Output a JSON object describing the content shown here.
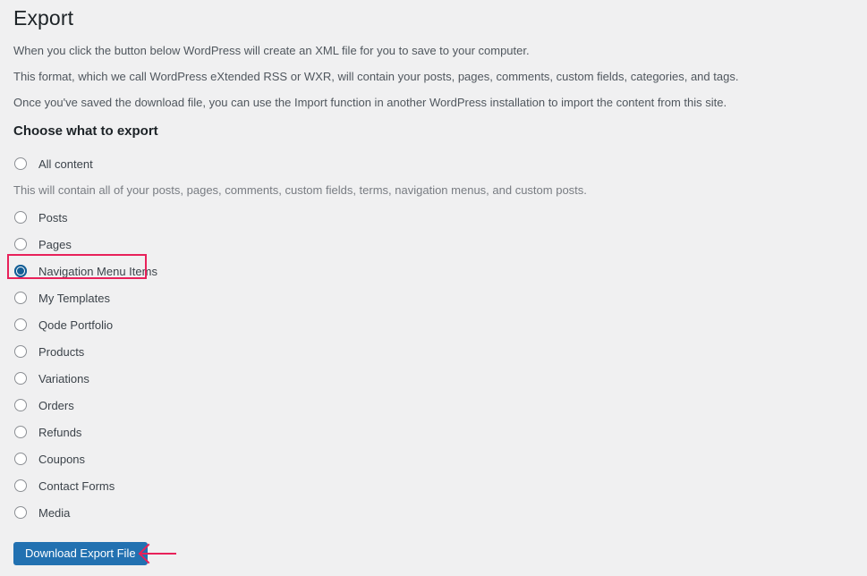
{
  "page": {
    "title": "Export",
    "paragraphs": [
      "When you click the button below WordPress will create an XML file for you to save to your computer.",
      "This format, which we call WordPress eXtended RSS or WXR, will contain your posts, pages, comments, custom fields, categories, and tags.",
      "Once you've saved the download file, you can use the Import function in another WordPress installation to import the content from this site."
    ],
    "section_heading": "Choose what to export"
  },
  "options": [
    {
      "label": "All content",
      "checked": false,
      "description": "This will contain all of your posts, pages, comments, custom fields, terms, navigation menus, and custom posts."
    },
    {
      "label": "Posts",
      "checked": false,
      "description": null
    },
    {
      "label": "Pages",
      "checked": false,
      "description": null
    },
    {
      "label": "Navigation Menu Items",
      "checked": true,
      "description": null
    },
    {
      "label": "My Templates",
      "checked": false,
      "description": null
    },
    {
      "label": "Qode Portfolio",
      "checked": false,
      "description": null
    },
    {
      "label": "Products",
      "checked": false,
      "description": null
    },
    {
      "label": "Variations",
      "checked": false,
      "description": null
    },
    {
      "label": "Orders",
      "checked": false,
      "description": null
    },
    {
      "label": "Refunds",
      "checked": false,
      "description": null
    },
    {
      "label": "Coupons",
      "checked": false,
      "description": null
    },
    {
      "label": "Contact Forms",
      "checked": false,
      "description": null
    },
    {
      "label": "Media",
      "checked": false,
      "description": null
    }
  ],
  "actions": {
    "download_button_label": "Download Export File"
  },
  "annotations": {
    "highlight_color": "#e8215a",
    "arrow_color": "#e8215a",
    "highlight_target": "Navigation Menu Items",
    "arrow_target": "Download Export File"
  },
  "colors": {
    "background": "#f0f0f1",
    "button_primary": "#2271b1",
    "radio_checked": "#135e96",
    "heading_text": "#1d2327",
    "body_text": "#50575e",
    "muted_text": "#787c82"
  }
}
